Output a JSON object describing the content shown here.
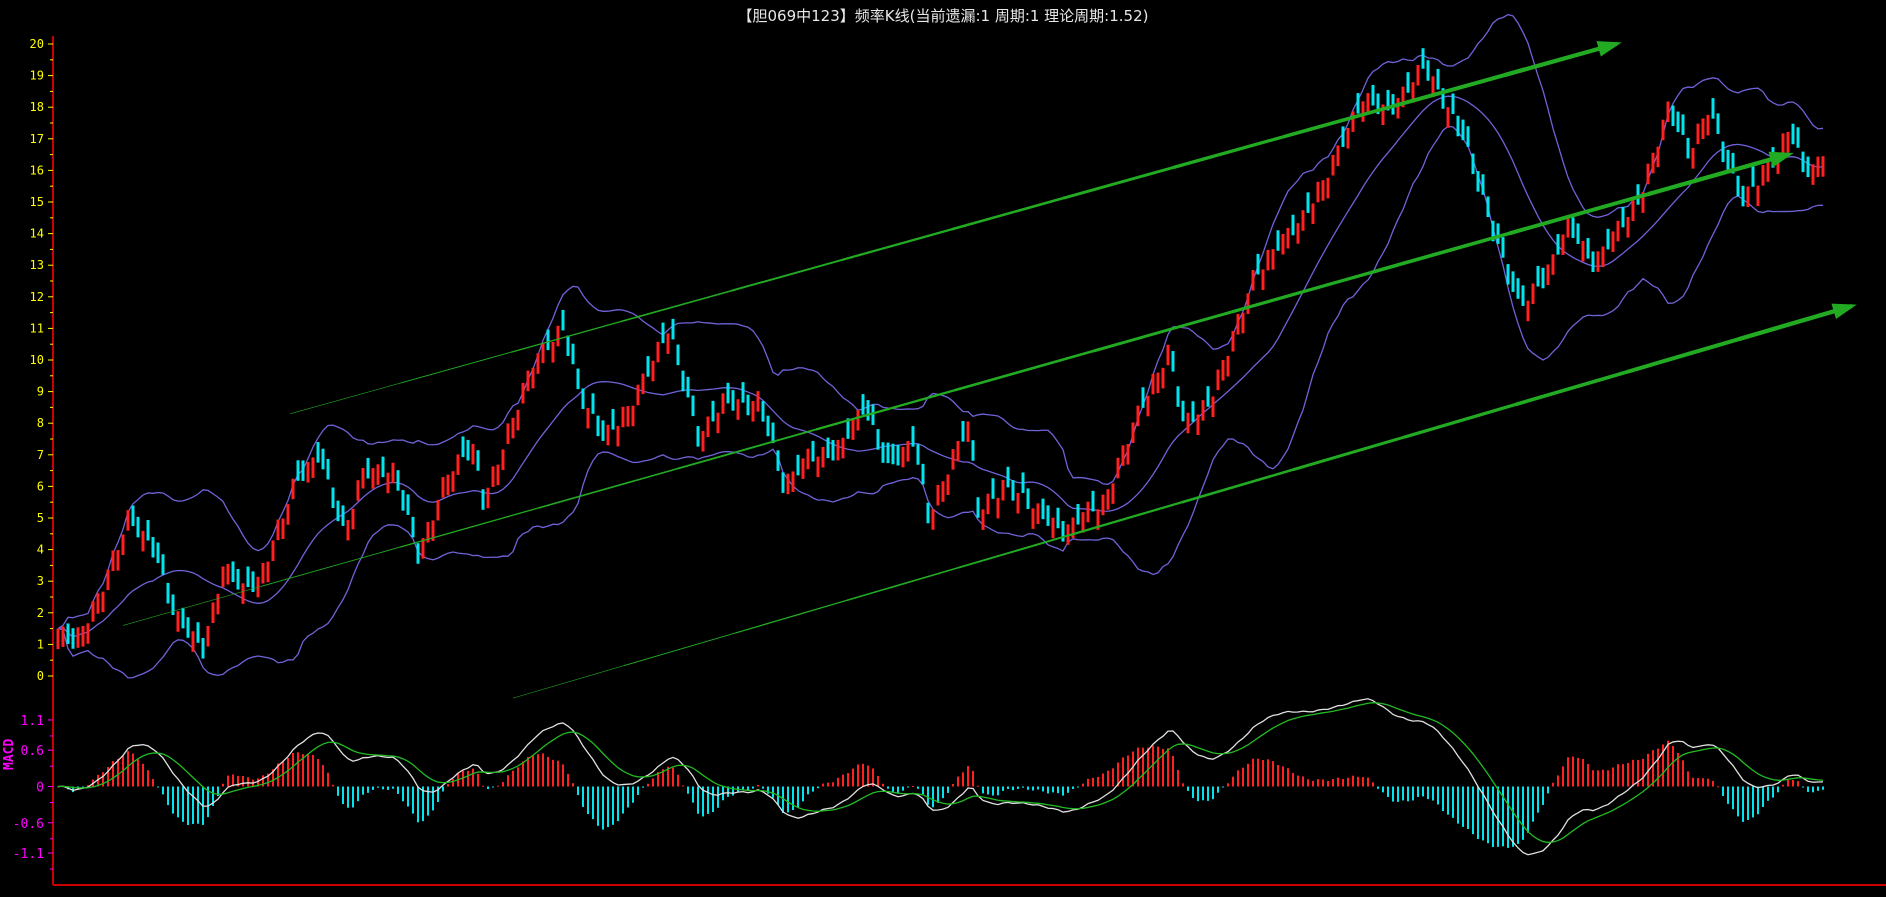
{
  "chart_data": {
    "type": "candlestick",
    "title": "【胆069中123】频率K线(当前遗漏:1 周期:1 理论周期:1.52)",
    "price_panel": {
      "ylim": [
        0,
        20
      ],
      "yticks": [
        "0",
        "1",
        "2",
        "3",
        "4",
        "5",
        "6",
        "7",
        "8",
        "9",
        "10",
        "11",
        "12",
        "13",
        "14",
        "15",
        "16",
        "17",
        "18",
        "19",
        "20"
      ],
      "close_keypoints": [
        [
          0,
          1.5
        ],
        [
          3,
          1.0
        ],
        [
          8,
          2.5
        ],
        [
          14,
          5
        ],
        [
          19,
          4
        ],
        [
          23,
          2
        ],
        [
          29,
          0.8
        ],
        [
          33,
          3.5
        ],
        [
          37,
          2.7
        ],
        [
          40,
          3
        ],
        [
          47,
          6
        ],
        [
          52,
          7
        ],
        [
          57,
          4.5
        ],
        [
          61,
          6.5
        ],
        [
          67,
          6.5
        ],
        [
          72,
          3.8
        ],
        [
          78,
          6.5
        ],
        [
          83,
          7.2
        ],
        [
          85,
          5.5
        ],
        [
          95,
          10
        ],
        [
          101,
          11
        ],
        [
          104,
          9
        ],
        [
          109,
          7.5
        ],
        [
          114,
          8.5
        ],
        [
          119,
          10
        ],
        [
          122,
          11
        ],
        [
          128,
          7.5
        ],
        [
          133,
          8.7
        ],
        [
          138,
          8.5
        ],
        [
          140,
          8.8
        ],
        [
          145,
          6
        ],
        [
          150,
          7
        ],
        [
          155,
          7
        ],
        [
          161,
          8.5
        ],
        [
          166,
          6.5
        ],
        [
          171,
          7.5
        ],
        [
          174,
          5
        ],
        [
          179,
          7
        ],
        [
          182,
          8
        ],
        [
          184,
          5.2
        ],
        [
          189,
          6
        ],
        [
          194,
          5.5
        ],
        [
          201,
          4.5
        ],
        [
          205,
          5.2
        ],
        [
          209,
          5.5
        ],
        [
          215,
          8
        ],
        [
          222,
          10.3
        ],
        [
          225,
          8
        ],
        [
          230,
          8.6
        ],
        [
          239,
          12.6
        ],
        [
          244,
          13.7
        ],
        [
          249,
          14.5
        ],
        [
          254,
          16
        ],
        [
          261,
          18.3
        ],
        [
          266,
          17.8
        ],
        [
          273,
          19.3
        ],
        [
          276,
          18.5
        ],
        [
          281,
          17
        ],
        [
          287,
          14
        ],
        [
          292,
          11.7
        ],
        [
          297,
          12.5
        ],
        [
          302,
          14.3
        ],
        [
          307,
          13
        ],
        [
          311,
          14
        ],
        [
          316,
          15
        ],
        [
          322,
          18
        ],
        [
          326,
          16.5
        ],
        [
          330,
          18
        ],
        [
          334,
          16
        ],
        [
          337,
          15
        ],
        [
          341,
          16
        ],
        [
          344,
          16.5
        ],
        [
          346,
          17.4
        ],
        [
          349,
          16
        ],
        [
          351,
          16
        ],
        [
          353,
          16.7
        ]
      ],
      "bollinger": {
        "period": 20,
        "k": 2
      },
      "trend_lines": [
        {
          "from": [
            46.5,
            8.3
          ],
          "to": [
            311.6,
            20.0
          ],
          "color": "#22aa22"
        },
        {
          "from": [
            13,
            1.6
          ],
          "to": [
            346,
            16.5
          ],
          "color": "#22aa22"
        },
        {
          "from": [
            91,
            -0.7
          ],
          "to": [
            358.6,
            11.7
          ],
          "color": "#22aa22"
        }
      ]
    },
    "macd_panel": {
      "label": "MACD",
      "yticks": [
        "1.1",
        "0.6",
        "0",
        "-0.6",
        "-1.1"
      ],
      "ytick_values": [
        1.1,
        0.6,
        0,
        -0.6,
        -1.1
      ],
      "params": [
        12,
        26,
        9
      ]
    },
    "colors": {
      "up": "#ff2020",
      "down": "#00e5ee",
      "band": "#6f63d8",
      "dif": "#e0e0e0",
      "dea": "#22bb22",
      "axis": "#cc0000",
      "price_tick": "#ffff00",
      "macd_tick": "#ff00ff"
    }
  }
}
